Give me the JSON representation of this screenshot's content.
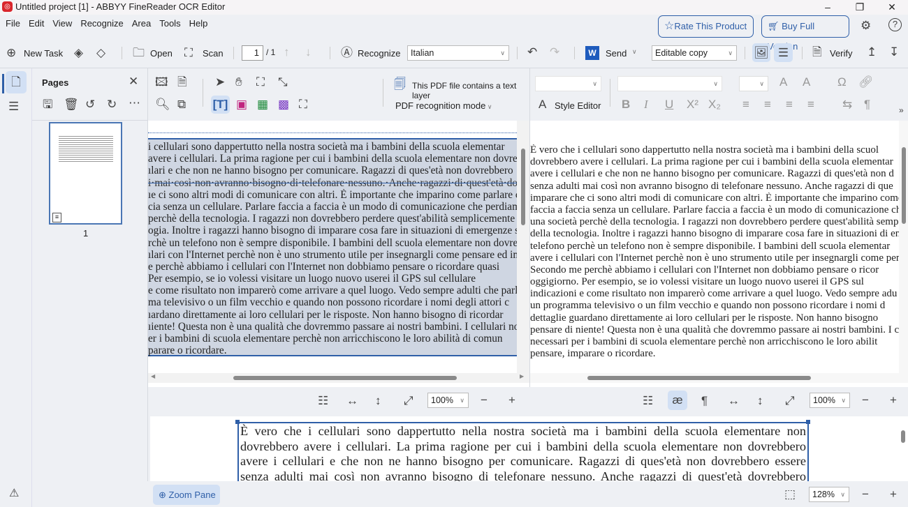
{
  "window": {
    "title": "Untitled project [1] - ABBYY FineReader OCR Editor",
    "minimize": "–",
    "maximize": "❐",
    "close": "✕"
  },
  "menu": [
    "File",
    "Edit",
    "View",
    "Recognize",
    "Area",
    "Tools",
    "Help"
  ],
  "header": {
    "rate": "Rate This Product",
    "buy": "Buy Full Version"
  },
  "toolbar": {
    "new_task": "New Task",
    "open": "Open",
    "scan": "Scan",
    "page_current": "1",
    "page_total": "/ 1",
    "recognize": "Recognize",
    "language": "Italian",
    "send": "Send",
    "output_mode": "Editable copy",
    "verify": "Verify"
  },
  "pages_panel": {
    "title": "Pages",
    "page_label": "1"
  },
  "image_pane": {
    "text_layer_notice": "This PDF file contains a text layer",
    "pdf_mode": "PDF recognition mode",
    "zoom": "100%",
    "lines": [
      " i cellulari sono dappertutto nella nostra società ma i bambini della scuola elementar",
      "avere i cellulari. La prima ragione per cui i bambini della scuola elementare non dovre",
      "ılari e che non ne hanno bisogno per comunicare. Ragazzi di ques'età non dovrebbero",
      "i·mai·così·non·avranno·bisogno·di·telefonare·nessuno.·Anche·ragazzi·di·quest'età·dovre",
      "ıe ci sono altri modi di comunicare con altri. È importante che imparino come parlare co",
      "cia senza un cellulare. Parlare faccia a faccia è un modo di comunicazione che perdiamo",
      " perchè della tecnologia. I ragazzi non dovrebbero perdere quest'abilità semplicemente p",
      "ogia. Inoltre i ragazzi hanno bisogno di imparare cosa fare in situazioni di emergenze se",
      "rchè un telefono non è sempre disponibile. I bambini dell scuola elementare non dovre",
      "ılari con l'Internet perchè non è uno strumento utile per insegnargli come pensare ed imp",
      "e perchè abbiamo i cellulari con l'Internet non dobbiamo pensare o ricordare quasi",
      "  Per esempio, se io volessi visitare un luogo nuovo userei il GPS sul cellulare",
      "e come risultato non imparerò come arrivare a quel luogo. Vedo sempre adulti che parl",
      "ma televisivo o un film vecchio e quando non possono ricordare i nomi degli attori c",
      "ıardano direttamente ai loro cellulari per le risposte. Non hanno bisogno di ricordar",
      "ıiente! Questa non è una qualità che dovremmo passare ai nostri bambini. I cellulari no",
      "er i bambini di scuola elementare perchè non arricchiscono le loro abilità di comun",
      "parare o ricordare."
    ]
  },
  "text_pane": {
    "style_editor": "Style Editor",
    "zoom": "100%",
    "lines": [
      "È vero che i cellulari sono dappertutto nella nostra società ma i bambini della scuol",
      "dovrebbero avere i cellulari. La prima ragione per cui i bambini della scuola elementar",
      "avere i cellulari e che non ne hanno bisogno per comunicare. Ragazzi di ques'età non d",
      "senza adulti mai così non avranno bisogno di telefonare nessuno. Anche ragazzi di que",
      "imparare che ci sono altri modi di comunicare con altri. È importante che imparino come",
      "faccia a faccia senza un cellulare. Parlare faccia a faccia è un modo di comunicazione ch",
      "una società perchè della tecnologia. I ragazzi non dovrebbero perdere quest'abilità semp",
      "della tecnologia. Inoltre i ragazzi hanno bisogno di imparare cosa fare in situazioni di en",
      "telefono perchè un telefono non è sempre disponibile. I bambini dell scuola elementar",
      "avere i cellulari con l'Internet perchè non è uno strumento utile per insegnargli come pen",
      "Secondo me perchè abbiamo i cellulari con l'Internet non dobbiamo pensare o ricor",
      "oggigiorno. Per esempio, se io volessi visitare un luogo nuovo userei il GPS sul",
      "indicazioni e come risultato non imparerò come arrivare a quel luogo. Vedo sempre adu",
      "un programma televisivo o un film vecchio e quando non possono ricordare i nomi d",
      "dettaglie guardano direttamente ai loro cellulari per le risposte. Non hanno bisogno",
      "pensare di niente! Questa non è una qualità che dovremmo passare ai nostri bambini. I c",
      "necessari per i bambini di scuola elementare perchè non arricchiscono le loro abilit",
      "pensare, imparare o ricordare."
    ]
  },
  "zoom_pane": {
    "button": "Zoom Pane",
    "zoom": "128%",
    "lines": [
      "È vero che i cellulari sono dappertutto nella nostra società ma i bambini della scuola elementare non",
      "dovrebbero avere i cellulari. La prima ragione per cui i bambini della scuola elementare non dovrebbero",
      "avere i cellulari e che non ne hanno bisogno per comunicare. Ragazzi di ques'età non dovrebbero essere",
      "senza adulti mai così non avranno bisogno di telefonare nessuno. Anche ragazzi di quest'età dovrebbero"
    ]
  },
  "colors": {
    "accent": "#2f5fa8",
    "selection": "#cfd6e2",
    "brand": "#d9262c"
  }
}
